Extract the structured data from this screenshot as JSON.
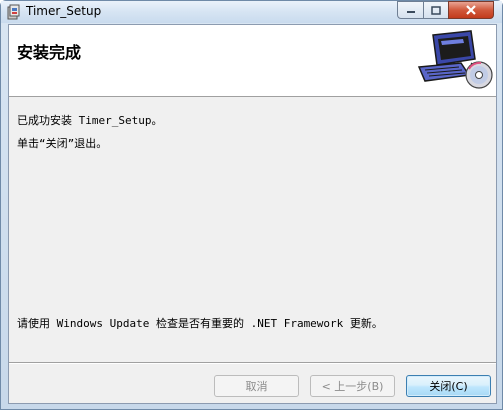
{
  "window": {
    "title": "Timer_Setup",
    "icon": "installer-icon",
    "controls": [
      "minimize-icon",
      "maximize-icon",
      "close-icon"
    ]
  },
  "banner": {
    "title": "安装完成",
    "art": "computer-cd-icon"
  },
  "messages": {
    "line1": "已成功安装 Timer_Setup。",
    "line2": "单击“关闭”退出。",
    "line3": "请使用 Windows Update 检查是否有重要的 .NET Framework 更新。"
  },
  "buttons": {
    "cancel": "取消",
    "back": "< 上一步(B)",
    "close": "关闭(C)"
  },
  "colors": {
    "close_button_red": "#c23a1c",
    "focused_button_border": "#3c7fb1"
  }
}
